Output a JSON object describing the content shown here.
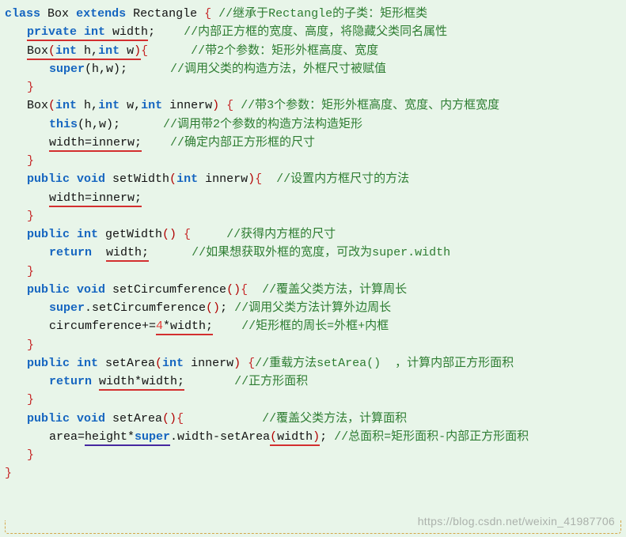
{
  "watermark": "https://blog.csdn.net/weixin_41987706",
  "lines": {
    "l1a": "class",
    "l1b": "Box",
    "l1c": "extends",
    "l1d": "Rectangle",
    "l1e": "{",
    "l1f": "//继承于Rectangle的子类：矩形框类",
    "l2a": "private int",
    "l2b": "width",
    "l2c": ";",
    "l2d": "//内部正方框的宽度、高度，将隐藏父类同名属性",
    "l3a": "Box",
    "l3b": "(",
    "l3c": "int",
    "l3d": " h,",
    "l3e": "int",
    "l3f": " w",
    "l3g": ")",
    "l3h": "{",
    "l3i": "//带2个参数：矩形外框高度、宽度",
    "l4a": "super",
    "l4b": "(h,w);",
    "l4c": "//调用父类的构造方法，外框尺寸被赋值",
    "l5a": "}",
    "l6a": "Box",
    "l6b": "(",
    "l6c": "int",
    "l6d": " h,",
    "l6e": "int",
    "l6f": " w,",
    "l6g": "int",
    "l6h": " innerw",
    "l6i": ")",
    "l6j": " {",
    "l6k": "//带3个参数：矩形外框高度、宽度、内方框宽度",
    "l7a": "this",
    "l7b": "(h,w);",
    "l7c": "//调用带2个参数的构造方法构造矩形",
    "l8a": "width=innerw;",
    "l8b": "//确定内部正方形框的尺寸",
    "l9a": "}",
    "l10a": "public void",
    "l10b": " setWidth",
    "l10c": "(",
    "l10d": "int",
    "l10e": " innerw",
    "l10f": ")",
    "l10g": "{",
    "l10h": "//设置内方框尺寸的方法",
    "l11a": "width=innerw;",
    "l12a": "}",
    "l13a": "public int",
    "l13b": " getWidth",
    "l13c": "()",
    "l13d": " {",
    "l13e": "//获得内方框的尺寸",
    "l14a": "return",
    "l14b": "width;",
    "l14c": "//如果想获取外框的宽度，可改为super.width",
    "l15a": "}",
    "l16a": "public void",
    "l16b": " setCircumference",
    "l16c": "()",
    "l16d": "{",
    "l16e": "//覆盖父类方法，计算周长",
    "l17a": "super",
    "l17b": ".setCircumference",
    "l17c": "()",
    "l17d": ";",
    "l17e": "//调用父类方法计算外边周长",
    "l18a": "circumference+=",
    "l18b": "4",
    "l18c": "*width;",
    "l18d": "//矩形框的周长=外框+内框",
    "l19a": "}",
    "l20a": "public int",
    "l20b": " setArea",
    "l20c": "(",
    "l20d": "int",
    "l20e": " innerw",
    "l20f": ")",
    "l20g": " {",
    "l20h": "//重载方法setArea()  ，计算内部正方形面积",
    "l21a": "return",
    "l21b": "width*width;",
    "l21c": "//正方形面积",
    "l22a": "}",
    "l23a": "public void",
    "l23b": " setArea",
    "l23c": "()",
    "l23d": "{",
    "l23e": "//覆盖父类方法，计算面积",
    "l24a": "area=",
    "l24b": "height*",
    "l24c": "super",
    "l24d": ".width-setArea",
    "l24e": "(",
    "l24f": "width",
    "l24g": ")",
    "l24h": ";",
    "l24i": "//总面积=矩形面积-内部正方形面积",
    "l25a": "}",
    "l26a": "}"
  }
}
